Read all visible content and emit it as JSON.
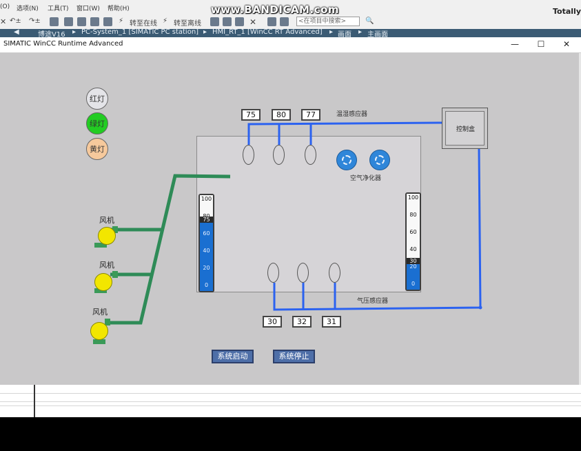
{
  "tia": {
    "menu": {
      "items": [
        "(O)",
        "选项(N)",
        "工具(T)",
        "窗口(W)",
        "帮助(H)"
      ]
    },
    "toolbar": {
      "go_online": "转至在线",
      "go_offline": "转至离线",
      "search_placeholder": "<在项目中搜索>"
    },
    "watermark": "www.BANDICAM.com",
    "brand": "Totally",
    "breadcrumb": [
      "博途V16",
      "PC-System_1 [SIMATIC PC station]",
      "HMI_RT_1 [WinCC RT Advanced]",
      "画面",
      "主画面"
    ]
  },
  "runtime": {
    "window_title": "SIMATIC WinCC Runtime Advanced",
    "controls": {
      "minimize": "—",
      "maximize": "☐",
      "close": "✕"
    }
  },
  "hmi": {
    "lamps": [
      {
        "label": "红灯",
        "color": "#e4e4e8"
      },
      {
        "label": "绿灯",
        "color": "#22cc22"
      },
      {
        "label": "黄灯",
        "color": "#f6c99c"
      }
    ],
    "temp_readings": [
      "75",
      "80",
      "77"
    ],
    "temp_sensor_label": "温湿感应器",
    "air_purifier_label": "空气净化器",
    "control_box_label": "控制盒",
    "pressure_readings": [
      "30",
      "32",
      "31"
    ],
    "pressure_sensor_label": "气压感应器",
    "fans": [
      {
        "label": "风机"
      },
      {
        "label": "风机"
      },
      {
        "label": "风机"
      }
    ],
    "gauge_left": {
      "ticks": [
        "100",
        "80",
        "60",
        "40",
        "20",
        "0"
      ],
      "value": "75",
      "level": 75
    },
    "gauge_right": {
      "ticks": [
        "100",
        "80",
        "60",
        "40",
        "20",
        "0"
      ],
      "value": "30",
      "level": 30
    },
    "buttons": {
      "start": "系统启动",
      "stop": "系统停止"
    },
    "colors": {
      "pipe_blue": "#2b62f0",
      "duct_green": "#2e8b57",
      "fill_blue": "#1a6fd1"
    }
  }
}
